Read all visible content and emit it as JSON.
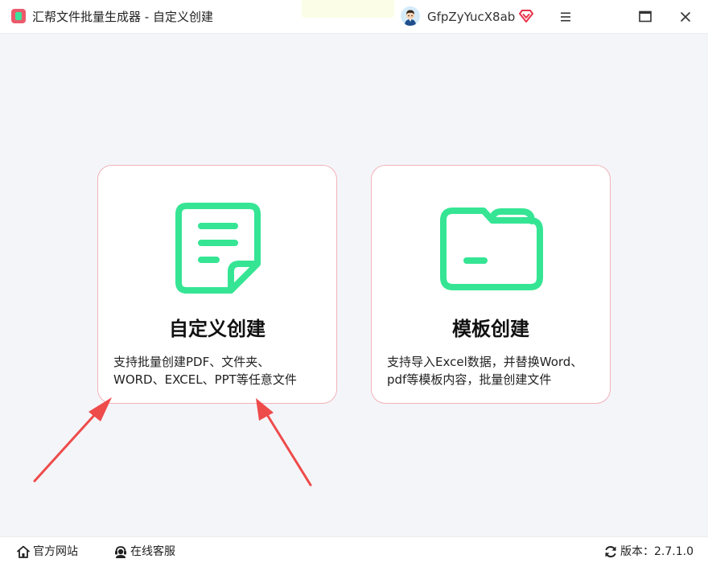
{
  "titlebar": {
    "app_title": "汇帮文件批量生成器 - 自定义创建",
    "username": "GfpZyYucX8ab",
    "icons": [
      "app-logo-icon",
      "avatar-icon",
      "vip-diamond-icon",
      "menu-icon",
      "maximize-icon",
      "close-icon"
    ]
  },
  "cards": [
    {
      "title": "自定义创建",
      "desc_line1": "支持批量创建PDF、文件夹、",
      "desc_line2": "WORD、EXCEL、PPT等任意文件",
      "icon": "document-icon"
    },
    {
      "title": "模板创建",
      "desc_line1": "支持导入Excel数据，并替换Word、",
      "desc_line2": "pdf等模板内容，批量创建文件",
      "icon": "folder-icon"
    }
  ],
  "footer": {
    "website_label": "官方网站",
    "service_label": "在线客服",
    "version_label": "版本：",
    "version_value": "2.7.1.0"
  },
  "colors": {
    "accent_green": "#35e594",
    "card_border": "#f2b3bb",
    "annotation_arrow": "#ee4b4b",
    "vip_red": "#e8334a"
  }
}
